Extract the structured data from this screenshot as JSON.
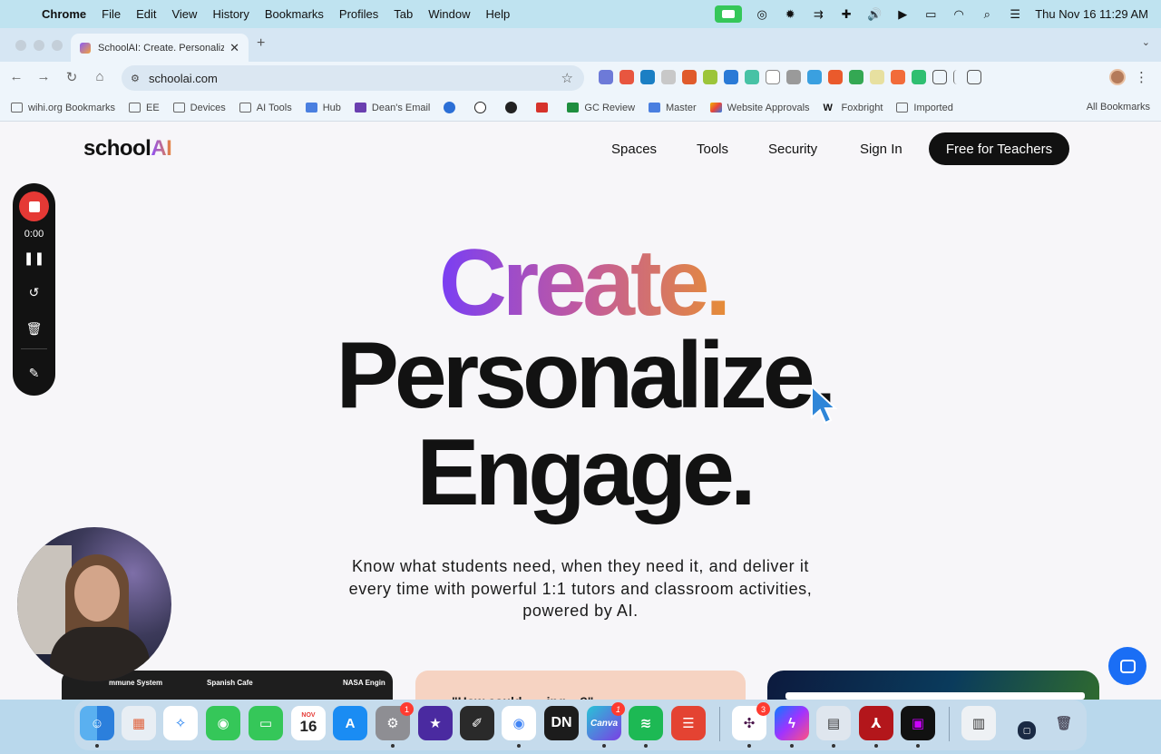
{
  "menubar": {
    "app_name": "Chrome",
    "menus": [
      "File",
      "Edit",
      "View",
      "History",
      "Bookmarks",
      "Profiles",
      "Tab",
      "Window",
      "Help"
    ],
    "datetime": "Thu Nov 16  11:29 AM"
  },
  "browser": {
    "tab_title": "SchoolAI: Create. Personaliz",
    "url": "schoolai.com",
    "bookmarks": [
      "wihi.org Bookmarks",
      "EE",
      "Devices",
      "AI Tools",
      "Hub",
      "Dean's Email",
      "GC Review",
      "Master",
      "Website Approvals",
      "Foxbright",
      "Imported"
    ],
    "all_bookmarks": "All Bookmarks"
  },
  "site": {
    "logo_prefix": "school",
    "logo_ai": "AI",
    "nav": [
      "Spaces",
      "Tools",
      "Security",
      "Sign In"
    ],
    "cta": "Free for Teachers",
    "headline_1": "Create.",
    "headline_2": "Personalize.",
    "headline_3": "Engage.",
    "subtitle": "Know what students need, when they need it, and deliver it every time with powerful 1:1 tutors and classroom activities, powered by AI.",
    "card1_labels": [
      "mmune System",
      "Spanish Cafe",
      "NASA Engin"
    ],
    "card2_text": "\"How could... ...ing ...?\""
  },
  "recorder": {
    "time": "0:00"
  },
  "dock": {
    "calendar_month": "NOV",
    "calendar_day": "16",
    "settings_badge": "1",
    "canva_badge": "1",
    "slack_badge": "3",
    "canva_label": "Canva",
    "dn_label": "DN"
  }
}
